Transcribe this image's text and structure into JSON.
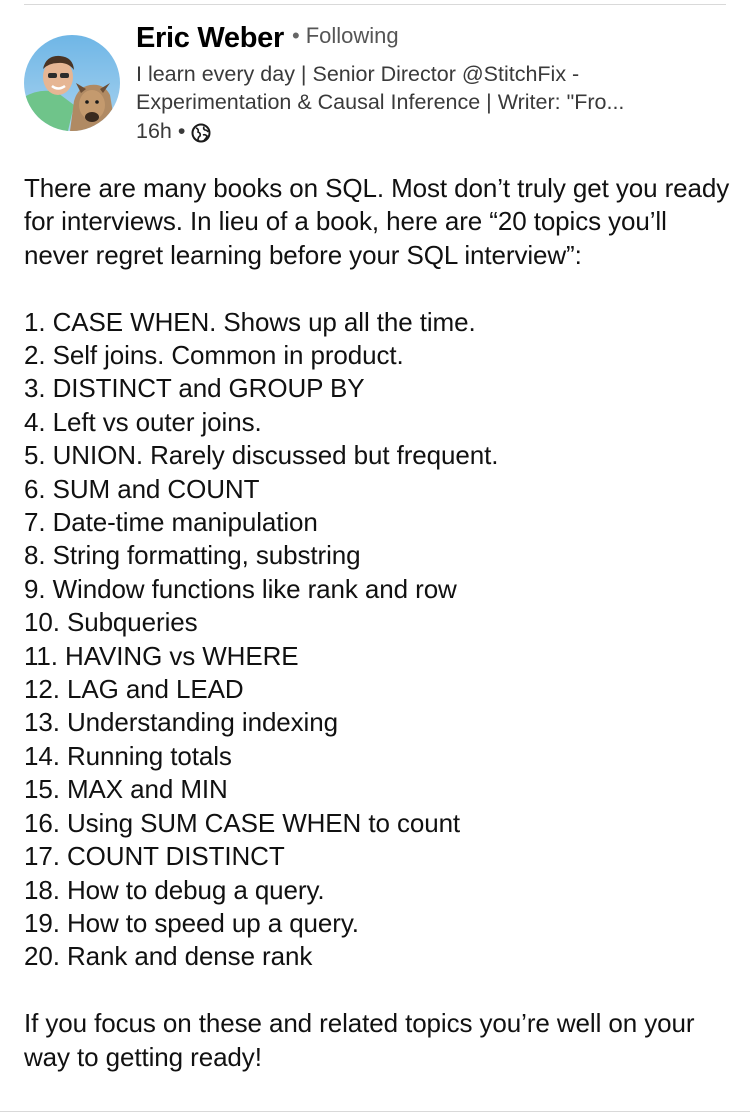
{
  "post": {
    "author": {
      "name": "Eric Weber",
      "follow_status": "Following",
      "headline_line1": "I learn every day | Senior Director @StitchFix -",
      "headline_line2": "Experimentation & Causal Inference | Writer: \"Fro...",
      "time_ago": "16h",
      "visibility_icon": "globe-icon",
      "avatar": "profile-photo"
    },
    "intro": "There are many books on SQL. Most don’t truly get you ready for interviews. In lieu of a book, here are “20 topics you’ll never regret learning before your SQL interview”:",
    "topics": [
      "1. CASE WHEN. Shows up all the time.",
      "2. Self joins. Common in product.",
      "3. DISTINCT and GROUP BY",
      "4. Left vs outer joins.",
      "5. UNION. Rarely discussed but frequent.",
      "6. SUM and COUNT",
      "7. Date-time manipulation",
      "8. String formatting, substring",
      "9. Window functions like rank and row",
      "10. Subqueries",
      "11. HAVING vs WHERE",
      "12. LAG and LEAD",
      "13. Understanding indexing",
      "14. Running totals",
      "15. MAX and MIN",
      "16. Using SUM CASE WHEN to count",
      "17. COUNT DISTINCT",
      "18. How to debug a query.",
      "19. How to speed up a query.",
      "20. Rank and dense rank"
    ],
    "outro": "If you focus on these and related topics you’re well on your way to getting ready!"
  },
  "colors": {
    "text": "#111111",
    "secondary_text": "#555555",
    "background": "#ffffff"
  }
}
